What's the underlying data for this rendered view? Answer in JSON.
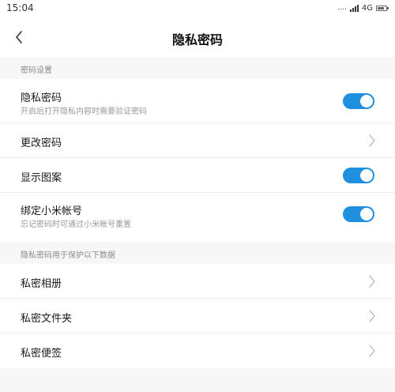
{
  "status_bar": {
    "time": "15:04",
    "dots": "....",
    "network": "4G",
    "signal_icon": "signal-bars-icon",
    "battery_icon": "battery-icon"
  },
  "header": {
    "back_icon": "chevron-left-icon",
    "title": "隐私密码"
  },
  "section_password_settings": {
    "header": "密码设置",
    "rows": [
      {
        "title": "隐私密码",
        "subtitle": "开启后打开隐私内容时需要验证密码",
        "control": "toggle",
        "on": true
      },
      {
        "title": "更改密码",
        "control": "chevron"
      },
      {
        "title": "显示图案",
        "control": "toggle",
        "on": true
      },
      {
        "title": "绑定小米帐号",
        "subtitle": "忘记密码时可通过小米帐号重置",
        "control": "toggle",
        "on": true
      }
    ]
  },
  "section_protected_data": {
    "header": "隐私密码用于保护以下数据",
    "rows": [
      {
        "title": "私密相册",
        "control": "chevron"
      },
      {
        "title": "私密文件夹",
        "control": "chevron"
      },
      {
        "title": "私密便签",
        "control": "chevron"
      }
    ]
  },
  "colors": {
    "accent": "#1f8fe0",
    "section_bg": "#f7f7f7",
    "title_text": "#1a1a1a",
    "secondary_text": "#999999"
  }
}
